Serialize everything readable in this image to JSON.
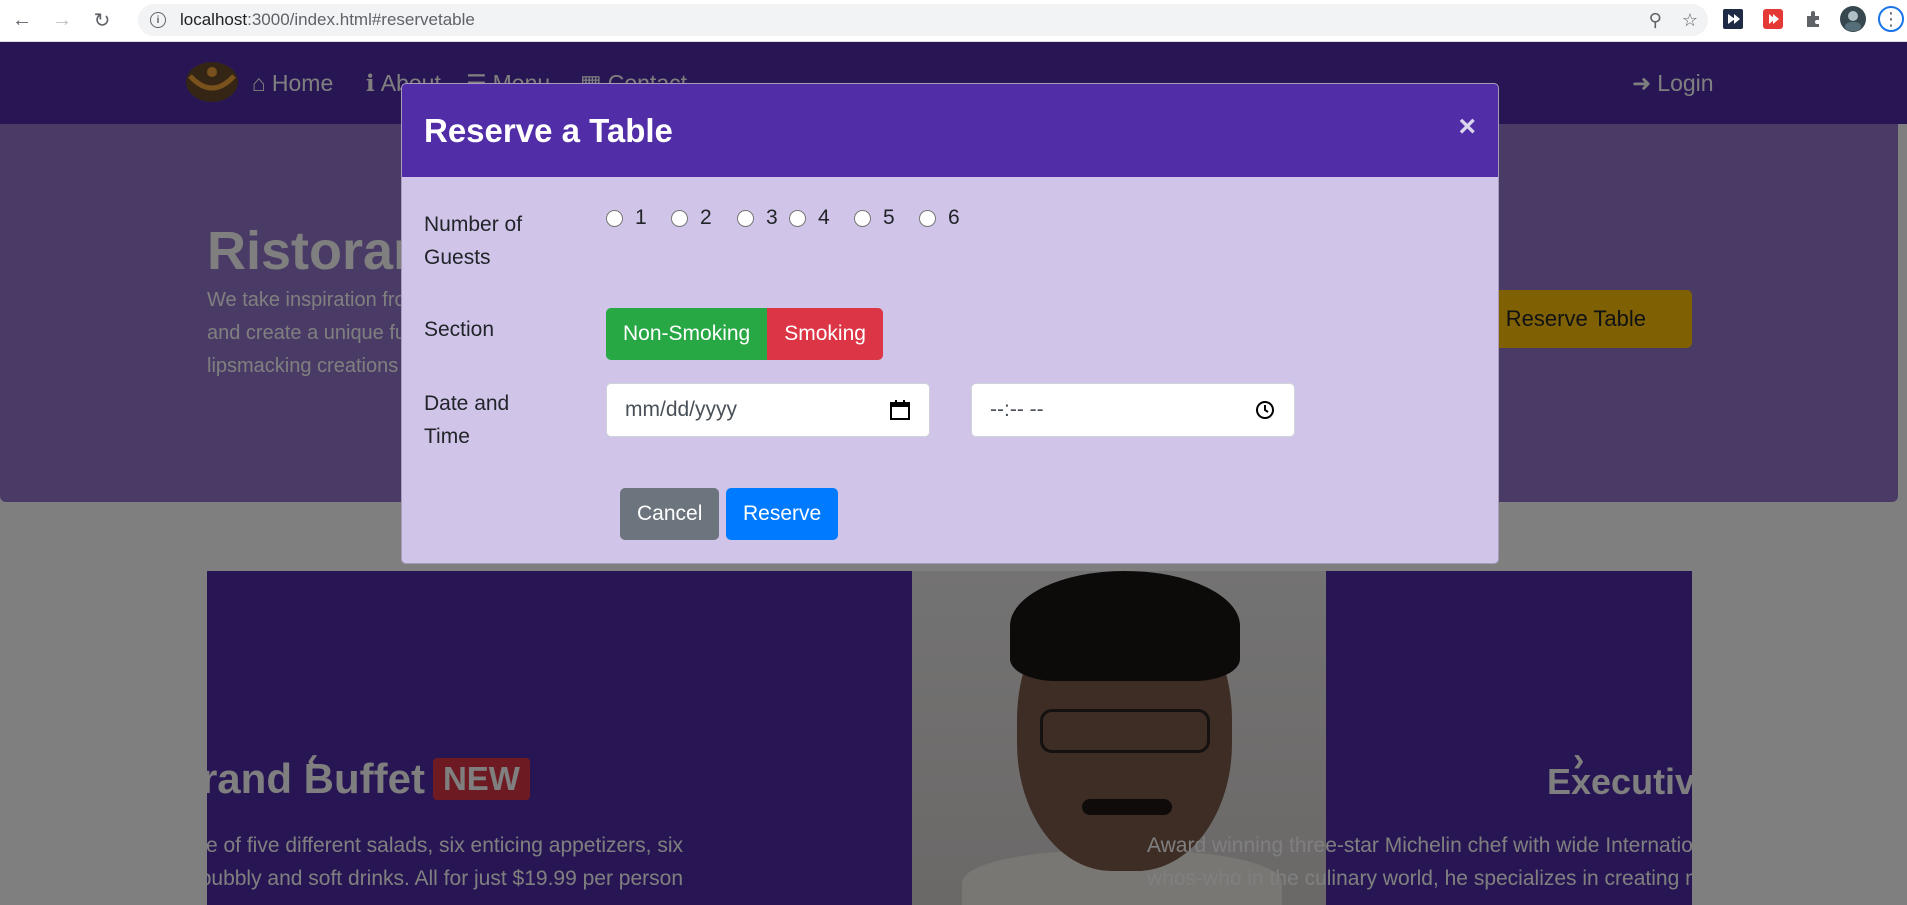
{
  "browser": {
    "url_host": "localhost",
    "url_path": ":3000/index.html#reservetable",
    "back_icon": "arrow-left-icon",
    "forward_icon": "arrow-right-icon",
    "reload_icon": "reload-icon"
  },
  "navbar": {
    "items": [
      {
        "label": "Home",
        "icon": "home-icon"
      },
      {
        "label": "About",
        "icon": "info-icon"
      },
      {
        "label": "Menu",
        "icon": "list-icon"
      },
      {
        "label": "Contact",
        "icon": "address-card-icon"
      }
    ],
    "login": "Login"
  },
  "jumbotron": {
    "title": "Ristorante con Fusion",
    "text": "We take inspiration from the World's best cuisines, and create a unique fusion experience. Our lipsmacking creations will tickle your culinary senses!",
    "reserve_button": "Reserve Table"
  },
  "carousel": {
    "slide1_title": "Weekend Grand Buffet",
    "slide1_badge": "NEW",
    "slide1_text_line1": "Featuring mouthwatering combinations with a choice of five different salads, six enticing appetizers, six",
    "slide1_text_line2": "main entrees and five choicest desserts. Free flowing bubbly and soft drinks. All for just $19.99 per person",
    "slide2_title": "Executive Chef",
    "slide2_text_line1": "Award winning three-star Michelin chef with wide International experience having worked closely with",
    "slide2_text_line2": "whos-who in the culinary world, he specializes in creating mouthwatering Indo-Italian fusion experiences."
  },
  "modal": {
    "title": "Reserve a Table",
    "close": "×",
    "guests_label": "Number of Guests",
    "guest_options": [
      "1",
      "2",
      "3",
      "4",
      "5",
      "6"
    ],
    "section_label": "Section",
    "section_options": [
      "Non-Smoking",
      "Smoking"
    ],
    "datetime_label": "Date and Time",
    "date_placeholder": "mm/dd/yyyy",
    "time_placeholder": "--:-- --",
    "cancel": "Cancel",
    "reserve": "Reserve"
  }
}
